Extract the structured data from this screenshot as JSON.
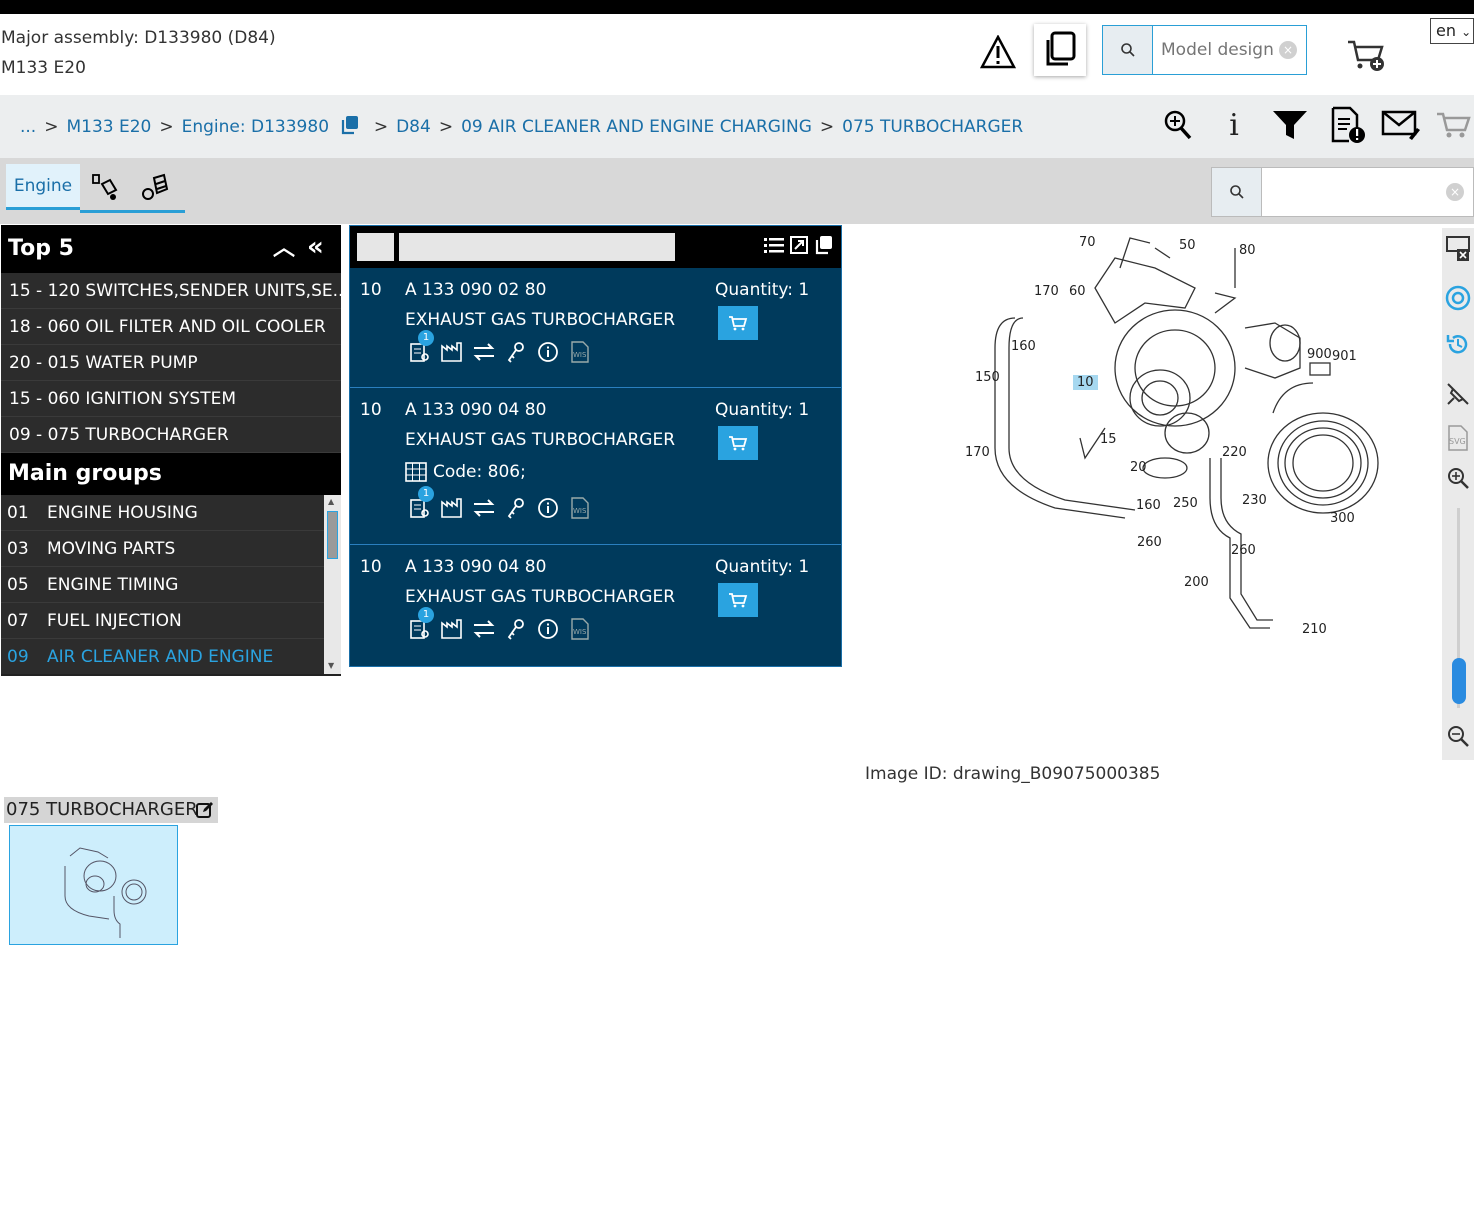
{
  "header": {
    "major_assembly": "Major assembly: D133980 (D84)",
    "engine_model": "M133 E20",
    "search_placeholder": "Model design",
    "language": "en"
  },
  "breadcrumb": {
    "ellipsis": "...",
    "items": [
      "M133 E20",
      "Engine: D133980",
      "D84",
      "09 AIR CLEANER AND ENGINE CHARGING",
      "075 TURBOCHARGER"
    ],
    "separator": ">"
  },
  "tabs": {
    "engine": "Engine"
  },
  "top5": {
    "title": "Top 5",
    "items": [
      "15 - 120 SWITCHES,SENDER UNITS,SE...",
      "18 - 060 OIL FILTER AND OIL COOLER",
      "20 - 015 WATER PUMP",
      "15 - 060 IGNITION SYSTEM",
      "09 - 075 TURBOCHARGER"
    ]
  },
  "main_groups": {
    "title": "Main groups",
    "items": [
      {
        "num": "01",
        "label": "ENGINE HOUSING"
      },
      {
        "num": "03",
        "label": "MOVING PARTS"
      },
      {
        "num": "05",
        "label": "ENGINE TIMING"
      },
      {
        "num": "07",
        "label": "FUEL INJECTION"
      },
      {
        "num": "09",
        "label": "AIR CLEANER AND ENGINE"
      }
    ]
  },
  "parts": [
    {
      "pos": "10",
      "number": "A 133 090 02 80",
      "desc": "EXHAUST GAS TURBOCHARGER",
      "qty": "Quantity: 1",
      "code": "",
      "badge": "1"
    },
    {
      "pos": "10",
      "number": "A 133 090 04 80",
      "desc": "EXHAUST GAS TURBOCHARGER",
      "qty": "Quantity: 1",
      "code": "Code: 806;",
      "badge": "1"
    },
    {
      "pos": "10",
      "number": "A 133 090 04 80",
      "desc": "EXHAUST GAS TURBOCHARGER",
      "qty": "Quantity: 1",
      "code": "",
      "badge": "1"
    }
  ],
  "drawing_labels": [
    "70",
    "50",
    "80",
    "170",
    "60",
    "160",
    "150",
    "10",
    "900",
    "901",
    "15",
    "170",
    "220",
    "20",
    "160",
    "250",
    "230",
    "300",
    "260",
    "260",
    "200",
    "210"
  ],
  "image_id": "Image ID: drawing_B09075000385",
  "thumbnail": {
    "label": "075 TURBOCHARGER"
  },
  "colors": {
    "accent": "#2aa3e0",
    "panel": "#003a5c",
    "dark": "#222222"
  }
}
